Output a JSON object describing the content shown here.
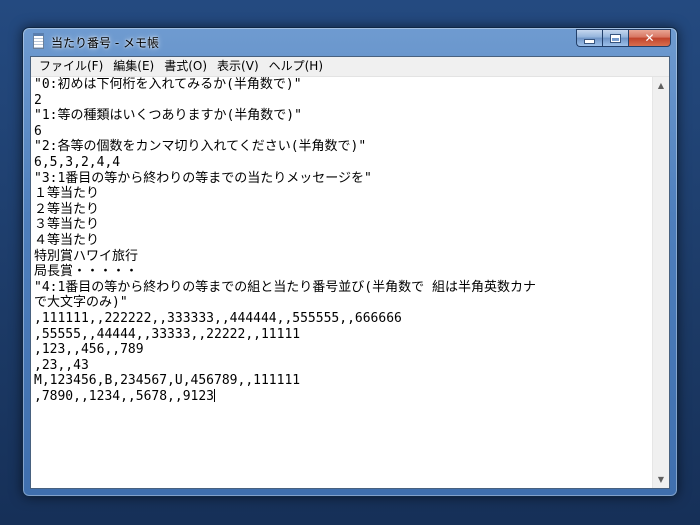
{
  "window": {
    "title": "当たり番号 - メモ帳",
    "close_glyph": "✕"
  },
  "menu": [
    "ファイル(F)",
    "編集(E)",
    "書式(O)",
    "表示(V)",
    "ヘルプ(H)"
  ],
  "editor": {
    "lines": [
      "\"0:初めは下何桁を入れてみるか(半角数で)\"",
      "2",
      "\"1:等の種類はいくつありますか(半角数で)\"",
      "6",
      "\"2:各等の個数をカンマ切り入れてください(半角数で)\"",
      "6,5,3,2,4,4",
      "\"3:1番目の等から終わりの等までの当たりメッセージを\"",
      "１等当たり",
      "２等当たり",
      "３等当たり",
      "４等当たり",
      "特別賞ハワイ旅行",
      "局長賞・・・・・",
      "\"4:1番目の等から終わりの等までの組と当たり番号並び(半角数で 組は半角英数カナ",
      "で大文字のみ)\"",
      ",111111,,222222,,333333,,444444,,555555,,666666",
      ",55555,,44444,,33333,,22222,,11111",
      ",123,,456,,789",
      ",23,,43",
      "M,123456,B,234567,U,456789,,111111",
      ",7890,,1234,,5678,,9123"
    ]
  },
  "scrollbar": {
    "up_glyph": "▲",
    "down_glyph": "▼"
  }
}
